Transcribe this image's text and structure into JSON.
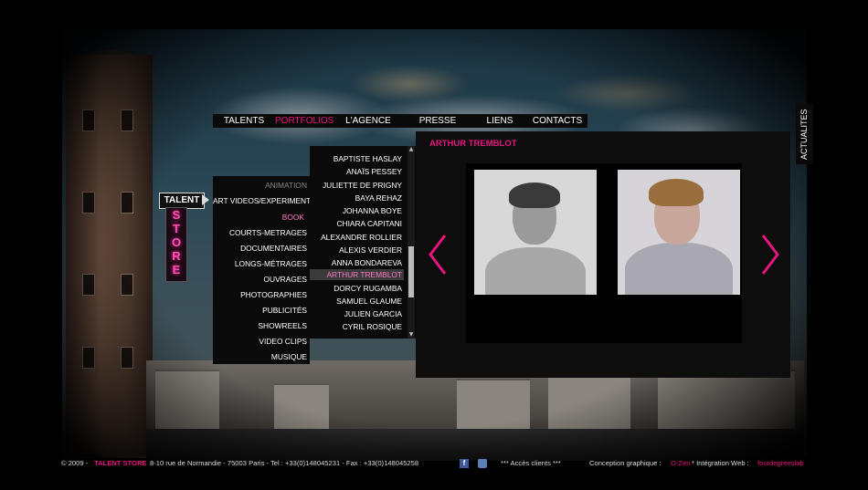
{
  "nav": {
    "items": [
      {
        "label": "TALENTS",
        "active": false
      },
      {
        "label": "PORTFOLIOS",
        "active": true
      },
      {
        "label": "L'AGENCE",
        "active": false
      },
      {
        "label": "PRESSE",
        "active": false
      },
      {
        "label": "LIENS",
        "active": false
      },
      {
        "label": "CONTACTS",
        "active": false
      }
    ]
  },
  "sign": {
    "talent": "TALENT",
    "store": "STORE"
  },
  "categories": [
    {
      "label": "ANIMATION",
      "header": true
    },
    {
      "label": "ART VIDEOS/EXPERIMENTALES"
    },
    {
      "label": "BOOK",
      "active": true
    },
    {
      "label": "COURTS-METRAGES"
    },
    {
      "label": "DOCUMENTAIRES"
    },
    {
      "label": "LONGS-MÉTRAGES"
    },
    {
      "label": "OUVRAGES"
    },
    {
      "label": "PHOTOGRAPHIES"
    },
    {
      "label": "PUBLICITÉS"
    },
    {
      "label": "SHOWREELS"
    },
    {
      "label": "VIDEO CLIPS"
    },
    {
      "label": "MUSIQUE"
    }
  ],
  "names": [
    {
      "label": "BAPTISTE HASLAY"
    },
    {
      "label": "ANAÏS PESSEY"
    },
    {
      "label": "JULIETTE DE PRIGNY"
    },
    {
      "label": "BAYA REHAZ"
    },
    {
      "label": "JOHANNA BOYE"
    },
    {
      "label": "CHIARA CAPITANI"
    },
    {
      "label": "ALEXANDRE ROLLIER"
    },
    {
      "label": "ALEXIS VERDIER"
    },
    {
      "label": "ANNA BONDAREVA"
    },
    {
      "label": "ARTHUR TREMBLOT",
      "active": true
    },
    {
      "label": "DORCY RUGAMBA"
    },
    {
      "label": "SAMUEL GLAUME"
    },
    {
      "label": "JULIEN GARCIA"
    },
    {
      "label": "CYRIL ROSIQUE"
    }
  ],
  "panel": {
    "title": "ARTHUR TREMBLOT"
  },
  "actualites": "ACTUALITES",
  "footer": {
    "copyright": "© 2009 -",
    "brand": "TALENT STORE",
    "address": "8-10 rue de Normandie - 75003 Paris - Tel : +33(0)148045231 - Fax : +33(0)148045258",
    "clients": "*** Accès clients ***",
    "design_label": "Conception graphique :",
    "design_name": "O-Zen",
    "integration_label": "* Intégration Web :",
    "integration_name": "fourdegreeslab"
  },
  "colors": {
    "accent": "#e8157f",
    "panel": "#0d0d0d",
    "text": "#ffffff"
  }
}
